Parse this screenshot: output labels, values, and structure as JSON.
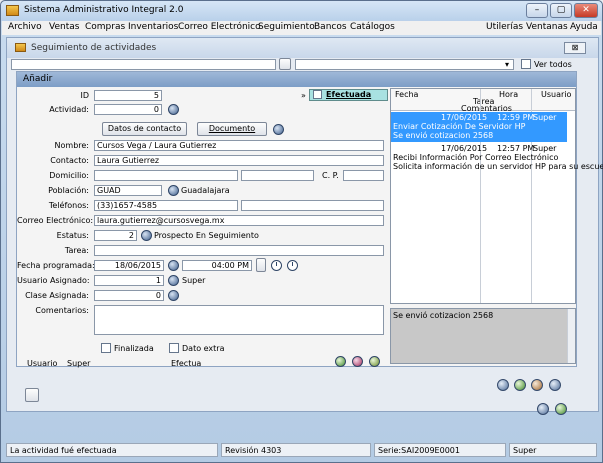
{
  "app": {
    "title": "Sistema Administrativo Integral 2.0"
  },
  "menu": {
    "left": [
      "Archivo",
      "Ventas",
      "Compras",
      "Inventarios",
      "Correo Electrónico",
      "Seguimiento",
      "Bancos",
      "Catálogos"
    ],
    "right": [
      "Utilerías",
      "Ventanas",
      "Ayuda"
    ]
  },
  "window": {
    "title": "Seguimiento de actividades",
    "close_label": "⊠",
    "ver_todos_label": "Ver todos"
  },
  "panel": {
    "title": "Añadir",
    "efectuada_label": "Efectuada",
    "id_label": "ID",
    "id_value": "5",
    "actividad_label": "Actividad:",
    "actividad_value": "0",
    "datos_contacto_button": "Datos de contacto",
    "documento_button": "Documento",
    "nombre_label": "Nombre:",
    "nombre_value": "Cursos Vega / Laura Gutierrez",
    "contacto_label": "Contacto:",
    "contacto_value": "Laura Gutierrez",
    "domicilio_label": "Domicilio:",
    "domicilio_value": "",
    "cp_label": "C. P.",
    "cp_value": "",
    "poblacion_label": "Población:",
    "poblacion_value": "GUAD",
    "poblacion_name": "Guadalajara",
    "telefonos_label": "Teléfonos:",
    "telefonos_value": "(33)1657-4585",
    "correo_label": "Correo Electrónico:",
    "correo_value": "laura.gutierrez@cursosvega.mx",
    "estatus_label": "Estatus:",
    "estatus_value": "2",
    "estatus_name": "Prospecto En Seguimiento",
    "tarea_label": "Tarea:",
    "tarea_value": "",
    "fecha_label": "Fecha programada:",
    "fecha_value": "18/06/2015",
    "hora_value": "04:00 PM",
    "usuario_asignado_label": "Usuario Asignado:",
    "usuario_asignado_value": "1",
    "usuario_asignado_name": "Super",
    "clase_label": "Clase Asignada:",
    "clase_value": "0",
    "comentarios_label": "Comentarios:",
    "finalizada_label": "Finalizada",
    "dato_extra_label": "Dato extra",
    "footer_usuario_label": "Usuario",
    "footer_usuario_value": "Super",
    "footer_efectua_label": "Efectua",
    "more_marker": "»"
  },
  "grid": {
    "columns": [
      "Fecha",
      "Hora",
      "Usuario"
    ],
    "subcolumns": [
      "Tarea",
      "Comentarios"
    ],
    "rows": [
      {
        "fecha": "17/06/2015",
        "hora": "12:59 PM",
        "usuario": "Super",
        "tarea": "Enviar Cotización De Servidor HP",
        "comentario": "Se envió cotizacion 2568",
        "selected": true
      },
      {
        "fecha": "17/06/2015",
        "hora": "12:57 PM",
        "usuario": "Super",
        "tarea": "Recibi Información Por Correo Electrónico",
        "comentario": "Solicita información de un servidor HP para su escuela.",
        "selected": false
      }
    ],
    "detail_text": "Se envió cotizacion 2568"
  },
  "status": {
    "message": "La actividad fué efectuada",
    "revision": "Revisión  4303",
    "serie": "Serie:SAI2009E0001",
    "user": "Super"
  },
  "colors": {
    "selection": "#3399ff",
    "efectuada_bg": "#a8e1e1",
    "panel_header": "#7d9dc6"
  }
}
